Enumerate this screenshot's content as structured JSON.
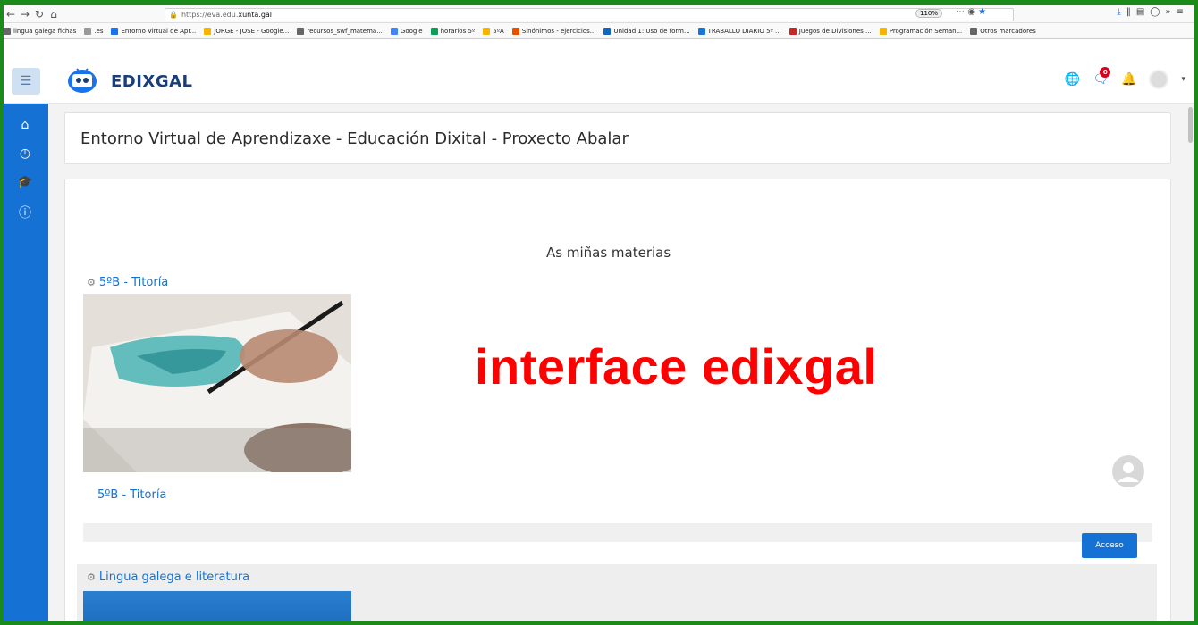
{
  "browser": {
    "url_prefix": "https://eva.edu.",
    "url_domain": "xunta.gal",
    "zoom": "110%",
    "bookmarks": [
      {
        "label": "lingua galega fichas",
        "color": "#666"
      },
      {
        "label": ".es",
        "color": "#999"
      },
      {
        "label": "Entorno Virtual de Apr...",
        "color": "#1a73e8"
      },
      {
        "label": "JORGE - JOSE - Google...",
        "color": "#f4b400"
      },
      {
        "label": "recursos_swf_matema...",
        "color": "#666"
      },
      {
        "label": "Google",
        "color": "#4285f4"
      },
      {
        "label": "horarios 5º",
        "color": "#0f9d58"
      },
      {
        "label": "5ºA",
        "color": "#f4b400"
      },
      {
        "label": "Sinónimos - ejercicios...",
        "color": "#e65100"
      },
      {
        "label": "Unidad 1: Uso de form...",
        "color": "#1565c0"
      },
      {
        "label": "TRABALLO DIARIO 5º ...",
        "color": "#1976d2"
      },
      {
        "label": "Juegos de Divisiones ...",
        "color": "#c62828"
      },
      {
        "label": "Programación Seman...",
        "color": "#f4b400"
      },
      {
        "label": "Otros marcadores",
        "color": "#666"
      }
    ]
  },
  "header": {
    "brand": "EDIXGAL",
    "message_badge": "0"
  },
  "page": {
    "title": "Entorno Virtual de Aprendizaxe - Educación Dixital - Proxecto Abalar",
    "section_title": "As miñas materias"
  },
  "courses": [
    {
      "title": "5ºB - Titoría",
      "footer": "5ºB - Titoría",
      "button": "Acceso"
    },
    {
      "title": "Lingua galega e literatura"
    }
  ],
  "overlay": "interface edixgal"
}
